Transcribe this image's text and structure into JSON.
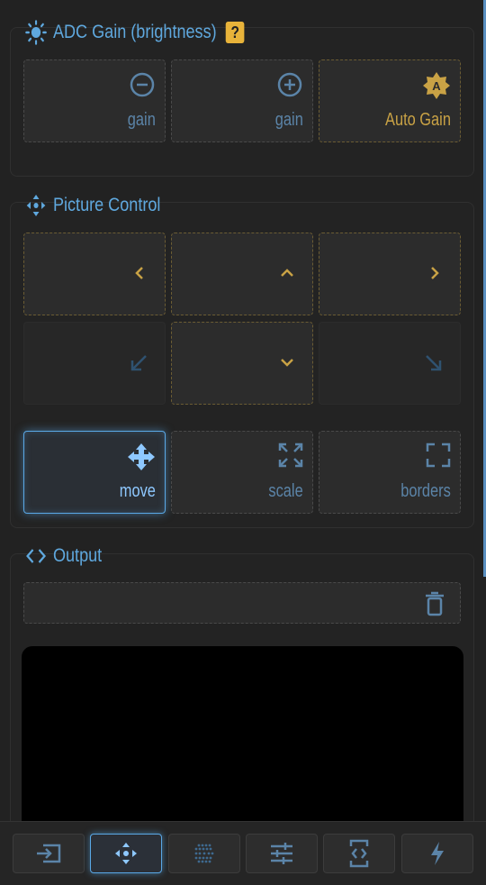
{
  "adc": {
    "title": "ADC Gain (brightness)",
    "help": "?",
    "buttons": [
      {
        "label": "gain",
        "icon": "minus-circle-icon"
      },
      {
        "label": "gain",
        "icon": "plus-circle-icon"
      },
      {
        "label": "Auto Gain",
        "icon": "auto-brightness-icon"
      }
    ]
  },
  "picture": {
    "title": "Picture Control",
    "arrows": [
      "arrow-left-icon",
      "arrow-up-icon",
      "arrow-right-icon",
      "arrow-down-left-icon",
      "arrow-down-icon",
      "arrow-down-right-icon"
    ],
    "modes": [
      {
        "label": "move",
        "icon": "move-icon",
        "active": true
      },
      {
        "label": "scale",
        "icon": "expand-icon",
        "active": false
      },
      {
        "label": "borders",
        "icon": "frame-corners-icon",
        "active": false
      }
    ]
  },
  "output": {
    "title": "Output",
    "clear_icon": "trash-icon"
  },
  "nav": [
    {
      "icon": "input-icon",
      "active": false
    },
    {
      "icon": "move-icon",
      "active": true
    },
    {
      "icon": "dots-grid-icon",
      "active": false
    },
    {
      "icon": "sliders-icon",
      "active": false
    },
    {
      "icon": "code-device-icon",
      "active": false
    },
    {
      "icon": "bolt-icon",
      "active": false
    }
  ],
  "colors": {
    "accent": "#5fa8de",
    "gold": "#c9a245",
    "background": "#222222"
  }
}
